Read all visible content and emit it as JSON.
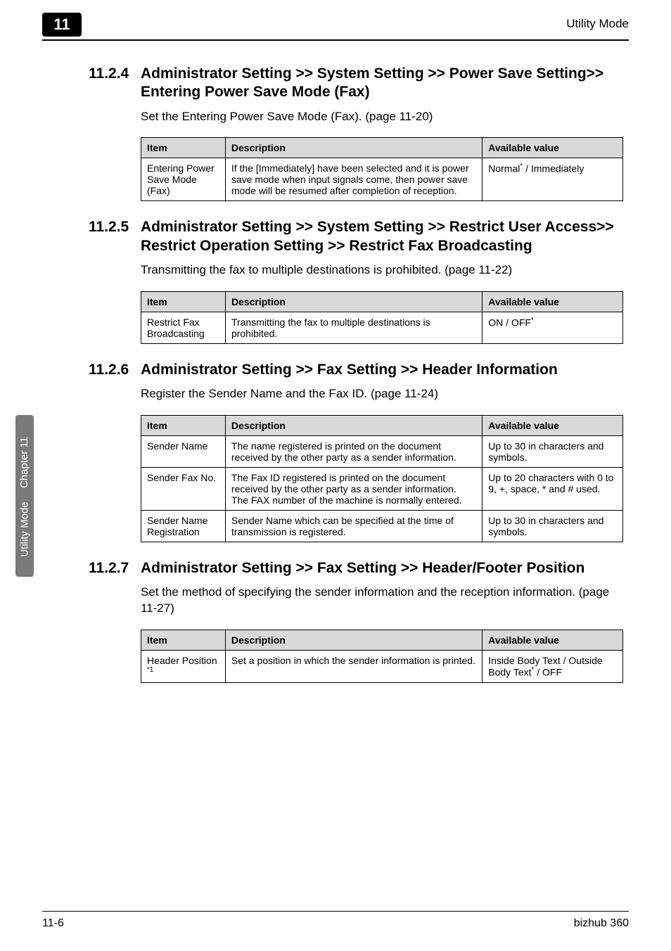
{
  "header": {
    "chapter_tab": "11",
    "right_text": "Utility Mode"
  },
  "sections": [
    {
      "number": "11.2.4",
      "title": "Administrator Setting >> System Setting >> Power Save Setting>> Entering Power Save Mode (Fax)",
      "body": "Set the Entering Power Save Mode (Fax). (page 11-20)",
      "table": {
        "headers": [
          "Item",
          "Description",
          "Available value"
        ],
        "rows": [
          {
            "item": "Entering Power Save Mode (Fax)",
            "desc": "If the [Immediately] have been selected and it is power save mode when input signals come, then power save mode will be resumed after completion of reception.",
            "avail_html": "Normal<sup>*</sup> / Immediately"
          }
        ]
      }
    },
    {
      "number": "11.2.5",
      "title": "Administrator Setting >> System Setting >> Restrict User Access>> Restrict Operation Setting >> Restrict Fax Broadcasting",
      "body": "Transmitting the fax to multiple destinations is prohibited. (page 11-22)",
      "table": {
        "headers": [
          "Item",
          "Description",
          "Available value"
        ],
        "rows": [
          {
            "item": "Restrict Fax Broadcasting",
            "desc": "Transmitting the fax to multiple destinations is prohibited.",
            "avail_html": "ON / OFF<sup>*</sup>"
          }
        ]
      }
    },
    {
      "number": "11.2.6",
      "title": "Administrator Setting >> Fax Setting >> Header Information",
      "body": "Register the Sender Name and the Fax ID. (page 11-24)",
      "table": {
        "headers": [
          "Item",
          "Description",
          "Available value"
        ],
        "rows": [
          {
            "item": "Sender Name",
            "desc": "The name registered is printed on the document received by the other party as a sender information.",
            "avail_html": "Up to 30 in characters and symbols."
          },
          {
            "item": "Sender Fax No.",
            "desc": "The Fax ID registered is printed on the document received by the other party as a sender information.\nThe FAX number of the machine is normally entered.",
            "avail_html": "Up to 20 characters with 0 to 9, +, space, * and # used."
          },
          {
            "item": "Sender Name Registration",
            "desc": "Sender Name which can be specified at the time of transmission is registered.",
            "avail_html": "Up to 30 in characters and symbols."
          }
        ]
      }
    },
    {
      "number": "11.2.7",
      "title": "Administrator Setting >> Fax Setting >> Header/Footer Position",
      "body": "Set the method of specifying the sender information and the reception information. (page 11-27)",
      "table": {
        "headers": [
          "Item",
          "Description",
          "Available value"
        ],
        "rows": [
          {
            "item_html": "Header Position <sup>*1</sup>",
            "desc": "Set a position in which the sender information is printed.",
            "avail_html": "Inside Body Text / Outside Body Text<sup>*</sup> / OFF"
          }
        ]
      }
    }
  ],
  "side_tab": {
    "top": "Chapter 11",
    "bottom": "Utility Mode"
  },
  "footer": {
    "left": "11-6",
    "right": "bizhub 360"
  }
}
